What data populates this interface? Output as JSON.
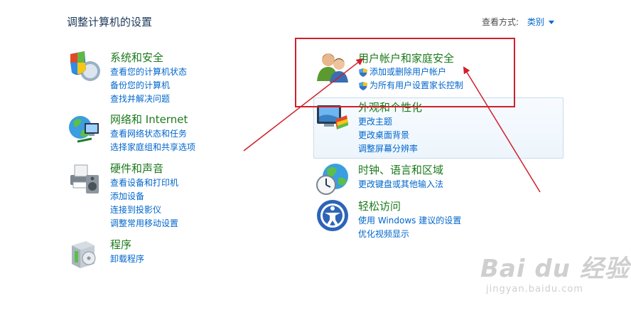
{
  "header": {
    "title": "调整计算机的设置",
    "view_by_label": "查看方式:",
    "view_by_value": "类别"
  },
  "categories": [
    {
      "id": "system",
      "title": "系统和安全",
      "links": [
        "查看您的计算机状态",
        "备份您的计算机",
        "查找并解决问题"
      ]
    },
    {
      "id": "network",
      "title": "网络和 Internet",
      "links": [
        "查看网络状态和任务",
        "选择家庭组和共享选项"
      ]
    },
    {
      "id": "hardware",
      "title": "硬件和声音",
      "links": [
        "查看设备和打印机",
        "添加设备",
        "连接到投影仪",
        "调整常用移动设置"
      ]
    },
    {
      "id": "programs",
      "title": "程序",
      "links": [
        "卸载程序"
      ]
    },
    {
      "id": "users",
      "title": "用户帐户和家庭安全",
      "links": [
        "添加或删除用户帐户",
        "为所有用户设置家长控制"
      ]
    },
    {
      "id": "appearance",
      "title": "外观和个性化",
      "links": [
        "更改主题",
        "更改桌面背景",
        "调整屏幕分辨率"
      ]
    },
    {
      "id": "clock",
      "title": "时钟、语言和区域",
      "links": [
        "更改键盘或其他输入法"
      ]
    },
    {
      "id": "ease",
      "title": "轻松访问",
      "links": [
        "使用 Windows 建议的设置",
        "优化视频显示"
      ]
    }
  ],
  "watermark": {
    "main": "Bai du 经验",
    "sub": "jingyan.baidu.com"
  },
  "colors": {
    "title_green": "#1c7a1c",
    "link_blue": "#0066cc",
    "annotation_red": "#d0202a"
  }
}
